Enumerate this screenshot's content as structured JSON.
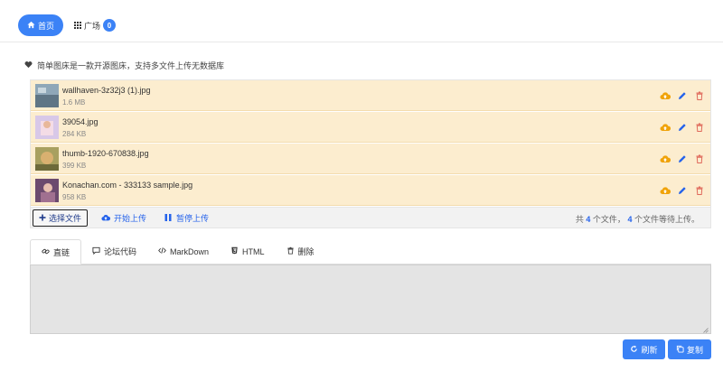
{
  "nav": {
    "home_label": "首页",
    "square_label": "广场",
    "square_badge": "0"
  },
  "intro": {
    "text": "简单图床是一款开源图床，支持多文件上传无数据库"
  },
  "files": [
    {
      "name": "wallhaven-3z32j3 (1).jpg",
      "size": "1.6 MB"
    },
    {
      "name": "39054.jpg",
      "size": "284 KB"
    },
    {
      "name": "thumb-1920-670838.jpg",
      "size": "399 KB"
    },
    {
      "name": "Konachan.com - 333133 sample.jpg",
      "size": "958 KB"
    }
  ],
  "toolbar": {
    "choose_label": "选择文件",
    "start_label": "开始上传",
    "pause_label": "暂停上传",
    "status_prefix": "共",
    "total_count": "4",
    "status_middle": "个文件，",
    "waiting_count": "4",
    "status_suffix": "个文件等待上传。"
  },
  "tabs": [
    {
      "label": "直链",
      "icon": "link-icon"
    },
    {
      "label": "论坛代码",
      "icon": "comment-icon"
    },
    {
      "label": "MarkDown",
      "icon": "code-icon"
    },
    {
      "label": "HTML",
      "icon": "html5-icon"
    },
    {
      "label": "删除",
      "icon": "trash-icon"
    }
  ],
  "actions": {
    "refresh_label": "刷新",
    "copy_label": "复制"
  },
  "colors": {
    "primary": "#3b82f6",
    "file_row_bg": "#fcedcf",
    "upload_icon": "#f0a30a",
    "edit_icon": "#2563eb",
    "delete_icon": "#e06a5c"
  }
}
